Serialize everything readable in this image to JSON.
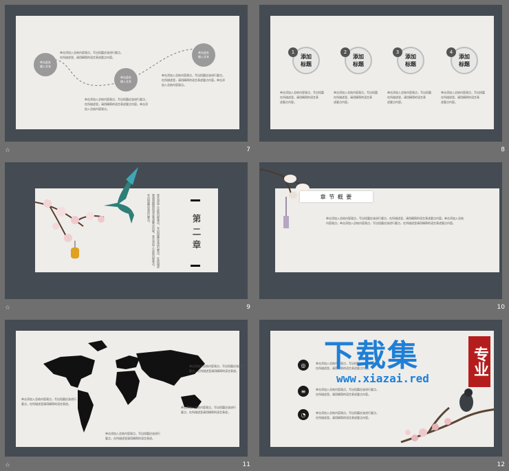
{
  "bottom_icon": "☆",
  "slides": [
    {
      "number": "7"
    },
    {
      "number": "8"
    },
    {
      "number": "9"
    },
    {
      "number": "10"
    },
    {
      "number": "11"
    },
    {
      "number": "12"
    }
  ],
  "s7": {
    "c1": "单击此处\n输入文本",
    "c2": "单击此处\n输入文本",
    "c3": "单击此处\n输入文本",
    "t1": "单击添加入总结内容观点，写出短篇应该进行要点，\n在所描述里，请用精简的语言表述要点内容。",
    "t2": "单击添加入总结内容观点，写出短篇应该进行要点，\n在所描述里，请用精简的语言表述要点内容。单击添\n加入总结内容观点。",
    "t3": "单击添加入总结内容观点，写出短篇应该进行要点，\n在所描述里，请用精简的语言表述要点内容。单击添\n加入总结内容观点。"
  },
  "s8": {
    "steps": [
      {
        "n": "1",
        "label": "添加\n标题",
        "desc": "单击添加入总结内容观点，写出短篇\n在所描述里，请用精简的语言表\n述要点内容。"
      },
      {
        "n": "2",
        "label": "添加\n标题",
        "desc": "单击添加入总结内容观点，写出短篇\n在所描述里，请用精简的语言表\n述要点内容。"
      },
      {
        "n": "3",
        "label": "添加\n标题",
        "desc": "单击添加入总结内容观点，写出短篇\n在所描述里，请用精简的语言表\n述要点内容。"
      },
      {
        "n": "4",
        "label": "添加\n标题",
        "desc": "单击添加入总结内容观点，写出短篇\n在所描述里，请用精简的语言表\n述要点内容。"
      }
    ]
  },
  "s9": {
    "chapter": "第二章",
    "vtext": "单击添加入总结内容观点，写出短篇应该进行要点，在所描述里请用精简的语言表述要点内容。单击添加入总结内容观点，写出短篇应该进行要点。"
  },
  "s10": {
    "title": "章 节 概 要",
    "text": "单击添加入总结内容观点，写出短篇应该进行要点，在所描述里，请用精简的语言表述要点内容。单击添加入总结\n内容观点。单击添加入总结内容观点，写出短篇应该进行要点，在所描述里请用精简的语言表述要点内容。"
  },
  "s11": {
    "t1": "单击添加入总结内容观点，写出短篇应该进行\n要点，在所描述里请用精简的语言表述。",
    "t2": "单击添加入总结内容观点，写出短篇应该进行\n要点，在所描述里请用精简的语言表述。",
    "t3": "单击添加入总结内容观点，写出短篇应该进行\n要点，在所描述里请用精简的语言表述。",
    "t4": "单击添加入总结内容观点，写出短篇应该进行\n要点，在所描述里请用精简的语言表述。"
  },
  "s12": {
    "items": [
      "单击添加入总结内容观点，写出短篇应该进行要点，\n在所描述里，请用精简的语言表述要点内容。",
      "单击添加入总结内容观点，写出短篇应该进行要点，\n在所描述里，请用精简的语言表述要点内容。",
      "单击添加入总结内容观点，写出短篇应该进行要点，\n在所描述里，请用精简的语言表述要点内容。"
    ],
    "watermark_big": "下载集",
    "watermark_seal": "专业",
    "watermark_url": "www.xiazai.red"
  }
}
